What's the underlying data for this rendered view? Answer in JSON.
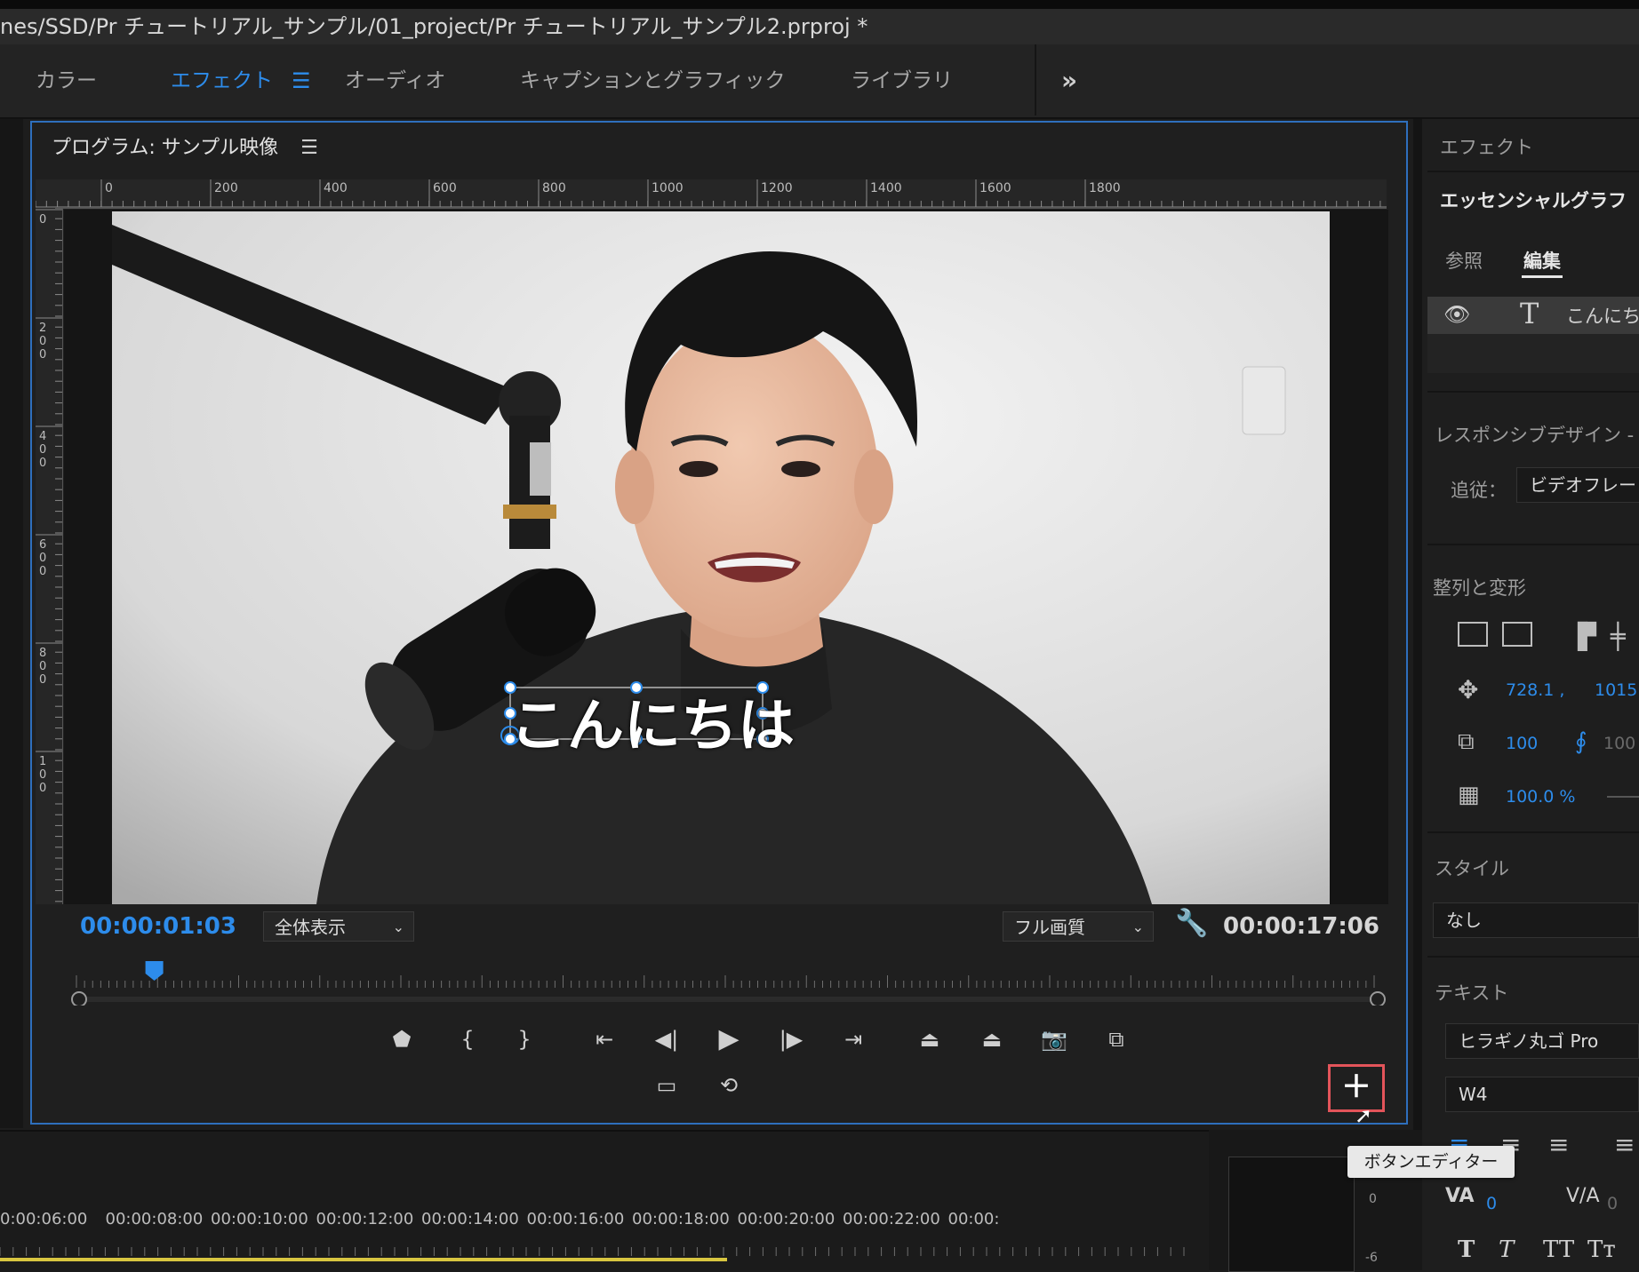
{
  "titlebar": {
    "path": "nes/SSD/Pr チュートリアル_サンプル/01_project/Pr チュートリアル_サンプル2.prproj *"
  },
  "workspace_tabs": [
    {
      "label": "カラー"
    },
    {
      "label": "エフェクト",
      "active": true
    },
    {
      "label": "オーディオ"
    },
    {
      "label": "キャプションとグラフィック"
    },
    {
      "label": "ライブラリ"
    }
  ],
  "workspace_overflow_icon": "double-chevron-right-icon",
  "monitor": {
    "title": "プログラム: サンプル映像",
    "h_ruler_ticks": [
      "0",
      "200",
      "400",
      "600",
      "800",
      "1000",
      "1200",
      "1400",
      "1600",
      "1800"
    ],
    "v_ruler_ticks": [
      "0",
      "200",
      "400",
      "600",
      "800",
      "100"
    ],
    "caption_text": "こんにちは",
    "current_timecode": "00:00:01:03",
    "zoom_select": "全体表示",
    "quality_select": "フル画質",
    "duration_timecode": "00:00:17:06",
    "playhead_fraction": 0.06,
    "controls_row1": [
      "marker-icon",
      "mark-in-icon",
      "mark-out-icon",
      "go-to-in-icon",
      "step-back-icon",
      "play-icon",
      "step-forward-icon",
      "go-to-out-icon",
      "lift-icon",
      "extract-icon",
      "export-frame-icon",
      "comparison-view-icon"
    ],
    "controls_row2": [
      "safe-margins-icon",
      "vr-video-icon"
    ],
    "button_editor_tooltip": "ボタンエディター",
    "accent": "#2d8ceb",
    "highlight": "#e3545a"
  },
  "right_panel": {
    "panel_title": "エフェクト",
    "essential_graphics_title": "エッセンシャルグラフ",
    "tabs": [
      "参照",
      "編集"
    ],
    "active_tab": "編集",
    "layer_name": "こんにち",
    "responsive_design_label": "レスポンシブデザイン -",
    "follow_label": "追従：",
    "follow_value": "ビデオフレー",
    "align_transform_label": "整列と変形",
    "position_x": "728.1 ,",
    "position_y": "1015.",
    "scale": "100",
    "scale_linked": "100",
    "opacity": "100.0 %",
    "style_label": "スタイル",
    "style_value": "なし",
    "text_label": "テキスト",
    "font_family": "ヒラギノ丸ゴ Pro",
    "font_weight": "W4",
    "kerning_value": "0",
    "tracking_value": "0"
  },
  "timeline": {
    "timecodes": [
      "0:00:06:00",
      "00:00:08:00",
      "00:00:10:00",
      "00:00:12:00",
      "00:00:14:00",
      "00:00:16:00",
      "00:00:18:00",
      "00:00:20:00",
      "00:00:22:00",
      "00:00:"
    ],
    "audio_meter_labels": [
      "0",
      "-6"
    ]
  }
}
